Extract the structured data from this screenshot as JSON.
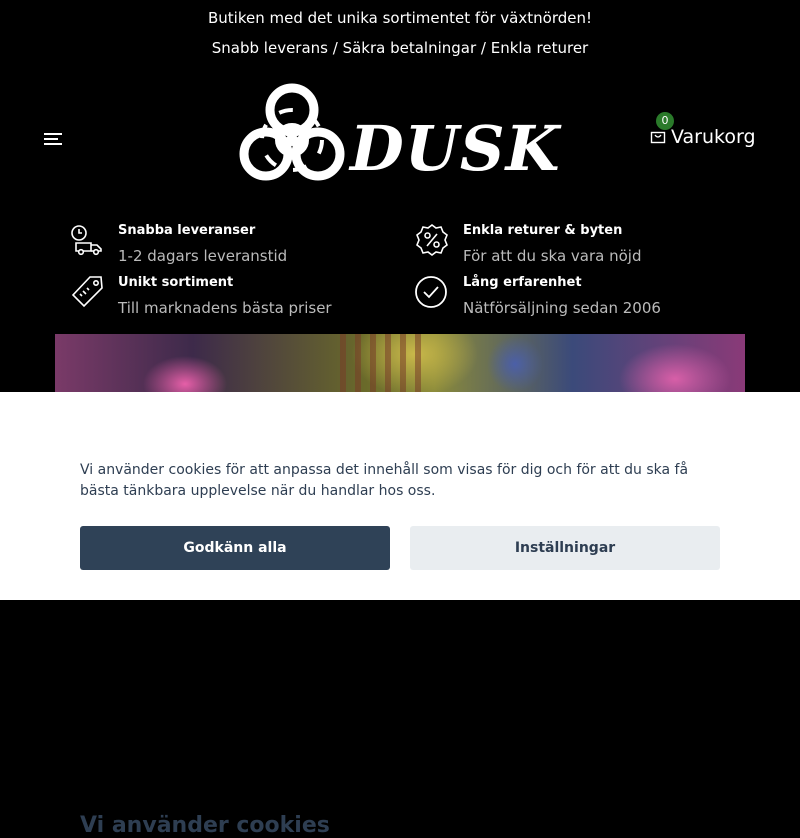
{
  "topbar": {
    "line1": "Butiken med det unika sortimentet för växtnörden!",
    "line2": "Snabb leverans / Säkra betalningar / Enkla returer"
  },
  "header": {
    "logo_text": "DUSK",
    "menu_icon": "hamburger-icon",
    "cart": {
      "count": "0",
      "label": "Varukorg",
      "icon": "shopping-bag-icon"
    }
  },
  "features": [
    {
      "title": "Snabba leveranser",
      "subtitle": "1-2 dagars leveranstid",
      "icon": "delivery-truck-icon"
    },
    {
      "title": "Enkla returer & byten",
      "subtitle": "För att du ska vara nöjd",
      "icon": "percent-badge-icon"
    },
    {
      "title": "Unikt sortiment",
      "subtitle": "Till marknadens bästa priser",
      "icon": "price-tag-icon"
    },
    {
      "title": "Lång erfarenhet",
      "subtitle": "Nätförsäljning sedan 2006",
      "icon": "check-circle-icon"
    }
  ],
  "cookie_banner": {
    "title": "Vi använder cookies",
    "text": "Vi använder cookies för att anpassa det innehåll som visas för dig och för att du ska få bästa tänkbara upplevelse när du handlar hos oss.",
    "accept_label": "Godkänn alla",
    "settings_label": "Inställningar"
  },
  "colors": {
    "background": "#000000",
    "cookie_button_primary": "#2f4257",
    "cookie_button_secondary": "#e9edf0",
    "cookie_text": "#2e3e52",
    "cart_badge": "#2a7a2a"
  }
}
